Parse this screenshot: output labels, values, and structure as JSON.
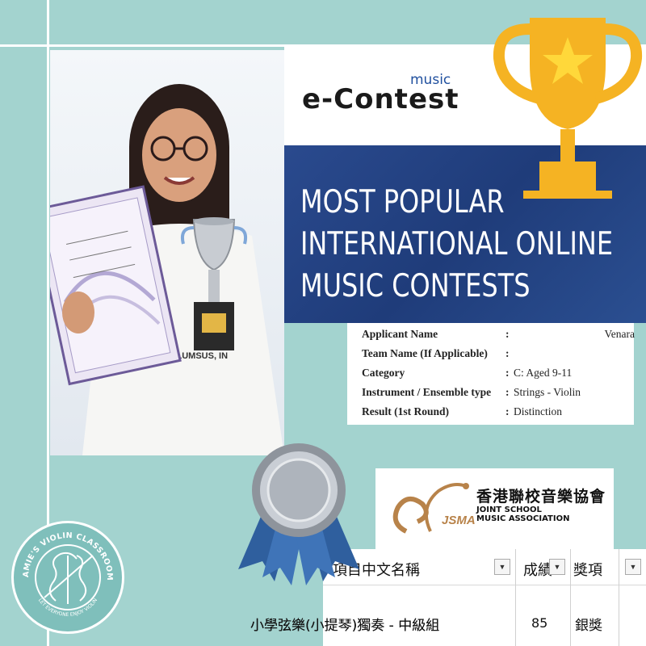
{
  "banner": {
    "logo_small": "music",
    "logo_main": "e-Contest",
    "headline_lines": [
      "MOST POPULAR",
      "INTERNATIONAL ONLINE",
      "MUSIC CONTESTS"
    ]
  },
  "photo": {
    "shirt_text": "COLUMSUS, IN"
  },
  "applicant_info": {
    "rows": [
      {
        "label": "Applicant Name",
        "colon": ":",
        "value": "Venara"
      },
      {
        "label": "Team Name (If Applicable)",
        "colon": ":",
        "value": ""
      },
      {
        "label": "Category",
        "colon": ":",
        "value": "C: Aged 9-11"
      },
      {
        "label": "Instrument / Ensemble type",
        "colon": ":",
        "value": "Strings - Violin"
      },
      {
        "label": "Result (1st Round)",
        "colon": ":",
        "value": "Distinction"
      }
    ]
  },
  "jsma": {
    "chinese_name": "香港聯校音樂協會",
    "english_line1": "JOINT SCHOOL",
    "english_line2": "MUSIC ASSOCIATION",
    "abbr": "JSMA"
  },
  "results_sheet": {
    "headers": [
      "項目中文名稱",
      "成績",
      "獎項"
    ],
    "row": {
      "item": "小學弦樂(小提琴)獨奏 - 中級組",
      "score": "85",
      "award": "銀獎"
    }
  },
  "logo": {
    "ring_text_top": "JAMIE'S VIOLIN CLASSROOM",
    "ring_text_bottom": "LET EVERYONE ENJOY VIOLIN"
  },
  "colors": {
    "background": "#a3d3cf",
    "banner_blue": "#2a4a8e",
    "trophy_gold": "#f5b323",
    "trophy_star": "#ffd83a",
    "ribbon_blue": "#2f5f9e",
    "jsma_gold": "#b8834a"
  },
  "icons": [
    "trophy-icon",
    "star-icon",
    "award-ribbon-icon",
    "violin-icon",
    "filter-dropdown-icon"
  ]
}
